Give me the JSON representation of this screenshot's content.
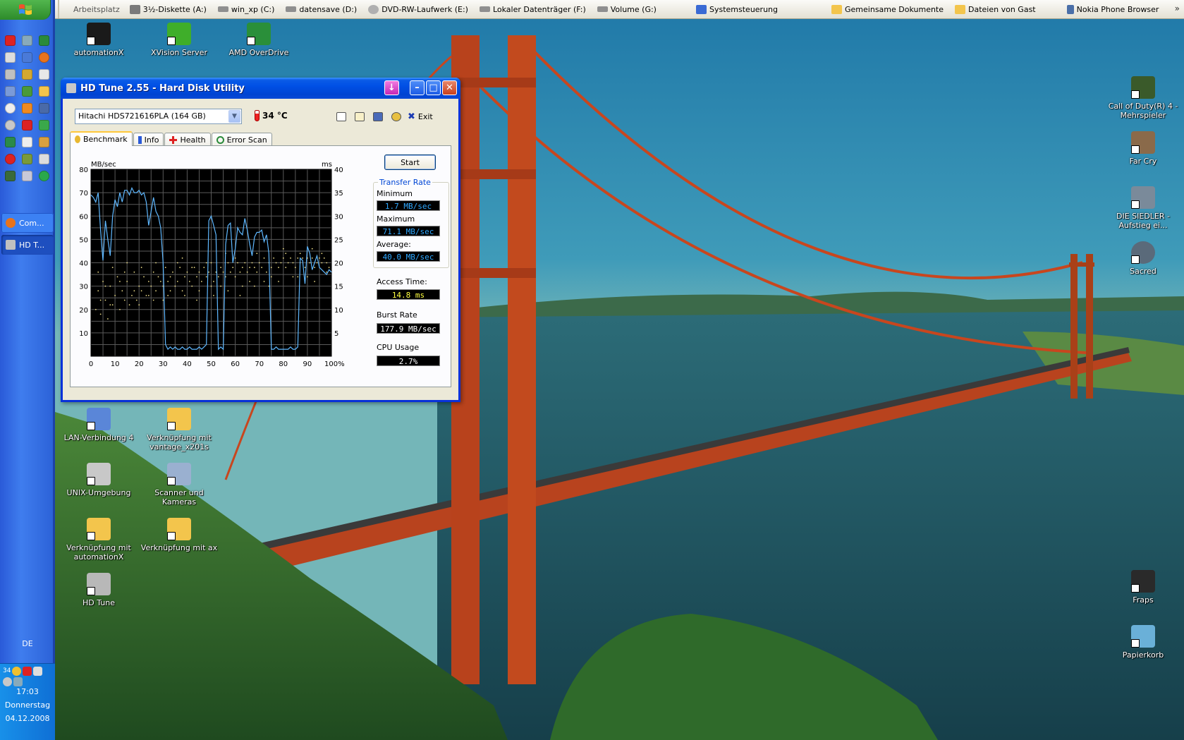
{
  "toolbar": {
    "label": "Arbeitsplatz",
    "items": [
      {
        "label": "3½-Diskette (A:)",
        "icon": "floppy-drive-icon",
        "color": "#7a7a7a"
      },
      {
        "label": "win_xp (C:)",
        "icon": "hard-drive-icon",
        "color": "#8f8f8f"
      },
      {
        "label": "datensave (D:)",
        "icon": "hard-drive-icon",
        "color": "#8f8f8f"
      },
      {
        "label": "DVD-RW-Laufwerk (E:)",
        "icon": "dvd-drive-icon",
        "color": "#b0b0b0"
      },
      {
        "label": "Lokaler Datenträger (F:)",
        "icon": "hard-drive-icon",
        "color": "#8f8f8f"
      },
      {
        "label": "Volume (G:)",
        "icon": "hard-drive-icon",
        "color": "#8f8f8f"
      },
      {
        "label": "Systemsteuerung",
        "icon": "control-panel-icon",
        "color": "#3a6ad4"
      },
      {
        "label": "Gemeinsame Dokumente",
        "icon": "folder-icon",
        "color": "#f3c54c"
      },
      {
        "label": "Dateien von Gast",
        "icon": "folder-icon",
        "color": "#f3c54c"
      },
      {
        "label": "Nokia Phone Browser",
        "icon": "phone-icon",
        "color": "#4a6fa8"
      }
    ],
    "more": "»"
  },
  "taskbar": {
    "tasks": [
      {
        "label": "Com...",
        "icon": "firefox-icon",
        "color": "#e8731c"
      },
      {
        "label": "HD T...",
        "icon": "hdtune-icon",
        "color": "#c0c0c0"
      }
    ],
    "language": "DE",
    "tray_temp": "34",
    "time": "17:03",
    "day": "Donnerstag",
    "date": "04.12.2008"
  },
  "desktop_icons": [
    {
      "label": "automationX",
      "color": "#1a1a1a"
    },
    {
      "label": "XVision Server",
      "color": "#3fae2a"
    },
    {
      "label": "AMD OverDrive",
      "color": "#2a8f3a"
    },
    {
      "label": "LAN-Verbindung 4",
      "color": "#5a86d8"
    },
    {
      "label": "Verknüpfung mit vantage_x201s",
      "color": "#f3c54c"
    },
    {
      "label": "UNIX-Umgebung",
      "color": "#c8c8c8"
    },
    {
      "label": "Scanner und Kameras",
      "color": "#9ab0d0"
    },
    {
      "label": "Verknüpfung mit automationX",
      "color": "#f3c54c"
    },
    {
      "label": "Verknüpfung mit ax",
      "color": "#f3c54c"
    },
    {
      "label": "HD Tune",
      "color": "#b8b8b8"
    },
    {
      "label": "Call of Duty(R) 4 - Mehrspieler",
      "color": "#3a5a2a"
    },
    {
      "label": "Far Cry",
      "color": "#8a6a4a"
    },
    {
      "label": "DIE SIEDLER - Aufstieg ei...",
      "color": "#7a8a9a"
    },
    {
      "label": "Sacred",
      "color": "#5a6a7a"
    },
    {
      "label": "Fraps",
      "color": "#2a2a2a"
    },
    {
      "label": "Papierkorb",
      "color": "#6ab0d8"
    }
  ],
  "window": {
    "title": "HD Tune 2.55 - Hard Disk Utility",
    "drive": "Hitachi HDS721616PLA (164 GB)",
    "temperature": "34 °C",
    "exit_label": "Exit",
    "tabs": [
      "Benchmark",
      "Info",
      "Health",
      "Error Scan"
    ],
    "start_label": "Start",
    "group_label": "Transfer Rate",
    "stats": {
      "minimum_label": "Minimum",
      "minimum": "1.7 MB/sec",
      "maximum_label": "Maximum",
      "maximum": "71.1 MB/sec",
      "average_label": "Average:",
      "average": "40.0 MB/sec",
      "access_label": "Access Time:",
      "access": "14.8 ms",
      "burst_label": "Burst Rate",
      "burst": "177.9 MB/sec",
      "cpu_label": "CPU Usage",
      "cpu": "2.7%"
    },
    "colors": {
      "transfer": "#5fb8ff",
      "access": "#f0e08a",
      "stat_cyan": "#2fa8ff",
      "stat_yellow": "#ffff40",
      "stat_white": "#ffffff"
    }
  },
  "chart_data": {
    "type": "line",
    "ylabel": "MB/sec",
    "y2label": "ms",
    "xlim": [
      0,
      100
    ],
    "ylim": [
      0,
      80
    ],
    "y2lim": [
      0,
      40
    ],
    "x_ticks": [
      "0",
      "10",
      "20",
      "30",
      "40",
      "50",
      "60",
      "70",
      "80",
      "90",
      "100%"
    ],
    "y_ticks": [
      "10",
      "20",
      "30",
      "40",
      "50",
      "60",
      "70",
      "80"
    ],
    "y2_ticks": [
      "5",
      "10",
      "15",
      "20",
      "25",
      "30",
      "35",
      "40"
    ],
    "grid": true,
    "series": [
      {
        "x": [
          0,
          1,
          2,
          3,
          4,
          5,
          6,
          7,
          8,
          9,
          10,
          11,
          12,
          13,
          14,
          15,
          16,
          17,
          18,
          19,
          20,
          21,
          22,
          23,
          24,
          25,
          26,
          27,
          28,
          29,
          30,
          31,
          32,
          33,
          34,
          35,
          36,
          37,
          38,
          39,
          40,
          41,
          42,
          43,
          44,
          45,
          46,
          47,
          48,
          49,
          50,
          51,
          52,
          53,
          54,
          55,
          56,
          57,
          58,
          59,
          60,
          61,
          62,
          63,
          64,
          65,
          66,
          67,
          68,
          69,
          70,
          71,
          72,
          73,
          74,
          75,
          76,
          77,
          78,
          79,
          80,
          81,
          82,
          83,
          84,
          85,
          86,
          87,
          88,
          89,
          90,
          91,
          92,
          93,
          94,
          95,
          96,
          97,
          98,
          99,
          100
        ],
        "values": [
          69,
          68,
          66,
          70,
          54,
          41,
          58,
          50,
          43,
          60,
          67,
          64,
          70,
          66,
          71,
          71,
          69,
          72,
          70,
          70,
          71,
          69,
          70,
          66,
          56,
          62,
          68,
          62,
          60,
          55,
          40,
          5,
          3,
          4,
          3,
          4,
          3,
          3,
          4,
          3,
          3,
          4,
          3,
          3,
          3,
          4,
          3,
          4,
          5,
          58,
          60,
          56,
          52,
          3,
          4,
          3,
          48,
          56,
          57,
          40,
          46,
          55,
          53,
          52,
          59,
          54,
          48,
          43,
          51,
          53,
          53,
          54,
          49,
          52,
          44,
          3,
          3,
          4,
          3,
          3,
          3,
          3,
          3,
          4,
          3,
          3,
          4,
          42,
          41,
          31,
          47,
          44,
          37,
          40,
          43,
          38,
          37,
          36,
          35,
          37,
          36
        ]
      }
    ],
    "access_time_ms": [
      [
        2,
        10
      ],
      [
        3,
        14
      ],
      [
        4,
        9
      ],
      [
        5,
        16
      ],
      [
        6,
        12
      ],
      [
        7,
        8
      ],
      [
        8,
        15
      ],
      [
        9,
        11
      ],
      [
        10,
        13
      ],
      [
        11,
        17
      ],
      [
        12,
        10
      ],
      [
        13,
        14
      ],
      [
        14,
        12
      ],
      [
        15,
        16
      ],
      [
        16,
        11
      ],
      [
        17,
        13
      ],
      [
        18,
        18
      ],
      [
        19,
        12
      ],
      [
        20,
        15
      ],
      [
        21,
        14
      ],
      [
        22,
        17
      ],
      [
        23,
        13
      ],
      [
        24,
        16
      ],
      [
        25,
        15
      ],
      [
        26,
        18
      ],
      [
        27,
        14
      ],
      [
        28,
        17
      ],
      [
        29,
        16
      ],
      [
        30,
        15
      ],
      [
        31,
        19
      ],
      [
        32,
        13
      ],
      [
        33,
        17
      ],
      [
        34,
        18
      ],
      [
        35,
        15
      ],
      [
        36,
        16
      ],
      [
        37,
        19
      ],
      [
        38,
        14
      ],
      [
        39,
        17
      ],
      [
        40,
        18
      ],
      [
        41,
        16
      ],
      [
        42,
        15
      ],
      [
        43,
        19
      ],
      [
        44,
        17
      ],
      [
        45,
        18
      ],
      [
        46,
        16
      ],
      [
        47,
        19
      ],
      [
        48,
        17
      ],
      [
        49,
        18
      ],
      [
        50,
        20
      ],
      [
        51,
        16
      ],
      [
        52,
        18
      ],
      [
        53,
        17
      ],
      [
        54,
        19
      ],
      [
        55,
        18
      ],
      [
        56,
        17
      ],
      [
        57,
        20
      ],
      [
        58,
        18
      ],
      [
        59,
        19
      ],
      [
        60,
        17
      ],
      [
        61,
        20
      ],
      [
        62,
        18
      ],
      [
        63,
        19
      ],
      [
        64,
        20
      ],
      [
        65,
        18
      ],
      [
        66,
        19
      ],
      [
        67,
        20
      ],
      [
        68,
        19
      ],
      [
        69,
        18
      ],
      [
        70,
        20
      ],
      [
        71,
        19
      ],
      [
        72,
        21
      ],
      [
        73,
        18
      ],
      [
        74,
        20
      ],
      [
        75,
        19
      ],
      [
        76,
        21
      ],
      [
        77,
        20
      ],
      [
        78,
        19
      ],
      [
        79,
        20
      ],
      [
        80,
        21
      ],
      [
        81,
        19
      ],
      [
        82,
        20
      ],
      [
        83,
        21
      ],
      [
        84,
        20
      ],
      [
        85,
        19
      ],
      [
        86,
        21
      ],
      [
        87,
        20
      ],
      [
        88,
        21
      ],
      [
        89,
        19
      ],
      [
        90,
        21
      ],
      [
        91,
        20
      ],
      [
        92,
        21
      ],
      [
        93,
        19
      ],
      [
        94,
        20
      ],
      [
        95,
        21
      ],
      [
        96,
        20
      ],
      [
        97,
        21
      ],
      [
        98,
        20
      ],
      [
        3,
        18
      ],
      [
        6,
        15
      ],
      [
        9,
        19
      ],
      [
        12,
        16
      ],
      [
        15,
        20
      ],
      [
        18,
        14
      ],
      [
        21,
        19
      ],
      [
        24,
        13
      ],
      [
        27,
        20
      ],
      [
        30,
        12
      ],
      [
        33,
        14
      ],
      [
        36,
        20
      ],
      [
        39,
        13
      ],
      [
        42,
        19
      ],
      [
        45,
        14
      ],
      [
        48,
        20
      ],
      [
        51,
        13
      ],
      [
        54,
        15
      ],
      [
        57,
        14
      ],
      [
        60,
        21
      ],
      [
        63,
        15
      ],
      [
        66,
        16
      ],
      [
        69,
        22
      ],
      [
        72,
        16
      ],
      [
        75,
        17
      ],
      [
        78,
        16
      ],
      [
        81,
        22
      ],
      [
        84,
        17
      ],
      [
        87,
        22
      ],
      [
        90,
        17
      ],
      [
        93,
        16
      ],
      [
        96,
        22
      ],
      [
        99,
        19
      ],
      [
        4,
        12
      ],
      [
        8,
        11
      ],
      [
        14,
        18
      ],
      [
        20,
        11
      ],
      [
        26,
        12
      ],
      [
        32,
        16
      ],
      [
        38,
        21
      ],
      [
        44,
        12
      ],
      [
        50,
        15
      ],
      [
        56,
        22
      ],
      [
        62,
        13
      ],
      [
        68,
        15
      ],
      [
        74,
        15
      ],
      [
        80,
        23
      ],
      [
        86,
        17
      ],
      [
        92,
        23
      ],
      [
        98,
        18
      ]
    ]
  }
}
